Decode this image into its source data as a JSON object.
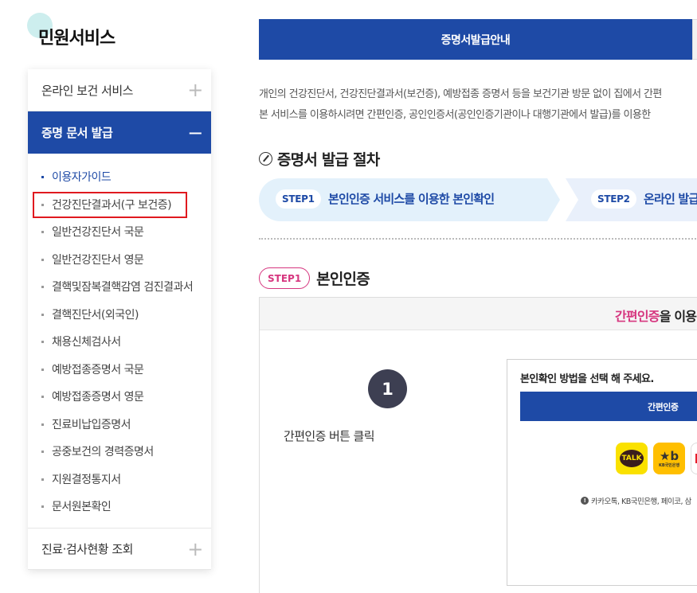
{
  "sidebar": {
    "title": "민원서비스",
    "menus": [
      {
        "label": "온라인 보건 서비스",
        "symbol": "+"
      },
      {
        "label": "증명 문서 발급",
        "symbol": "−"
      },
      {
        "label": "진료·검사현황 조회",
        "symbol": "+"
      }
    ],
    "items": [
      "이용자가이드",
      "건강진단결과서(구 보건증)",
      "일반건강진단서 국문",
      "일반건강진단서 영문",
      "결핵및잠복결핵감염 검진결과서",
      "결핵진단서(외국인)",
      "채용신체검사서",
      "예방접종증명서 국문",
      "예방접종증명서 영문",
      "진료비납입증명서",
      "공중보건의 경력증명서",
      "지원결정통지서",
      "문서원본확인"
    ]
  },
  "main": {
    "tab": "증명서발급안내",
    "intro": [
      "개인의 건강진단서, 건강진단결과서(보건증), 예방접종 증명서 등을 보건기관 방문 없이 집에서 간편",
      "본 서비스를 이용하시려면 간편인증, 공인인증서(공인인증기관이나 대행기관에서 발급)를 이용한"
    ],
    "procedure_title": "증명서 발급 절차",
    "steps": [
      {
        "badge": "STEP1",
        "label": "본인인증 서비스를 이용한 본인확인"
      },
      {
        "badge": "STEP2",
        "label": "온라인 발급"
      }
    ],
    "step1_badge": "STEP1",
    "step1_title": "본인인증",
    "panel": {
      "head_highlight": "간편인증",
      "head_rest": "을 이용",
      "number": "1",
      "desc": "간편인증 버튼 클릭",
      "bubble_title": "본인확인 방법을 선택 해 주세요.",
      "bubble_bar": "간편인증",
      "apps": {
        "kakao": "TALK",
        "kb_symbol": "★b",
        "kb_text": "KB국민은행"
      },
      "note": "카카오톡, KB국민은행, 페이코, 삼"
    }
  },
  "colors": {
    "primary": "#1e4aa6",
    "accent": "#d6367f",
    "highlight_box": "#e0191f",
    "step_bg": "#e3f1fb"
  }
}
